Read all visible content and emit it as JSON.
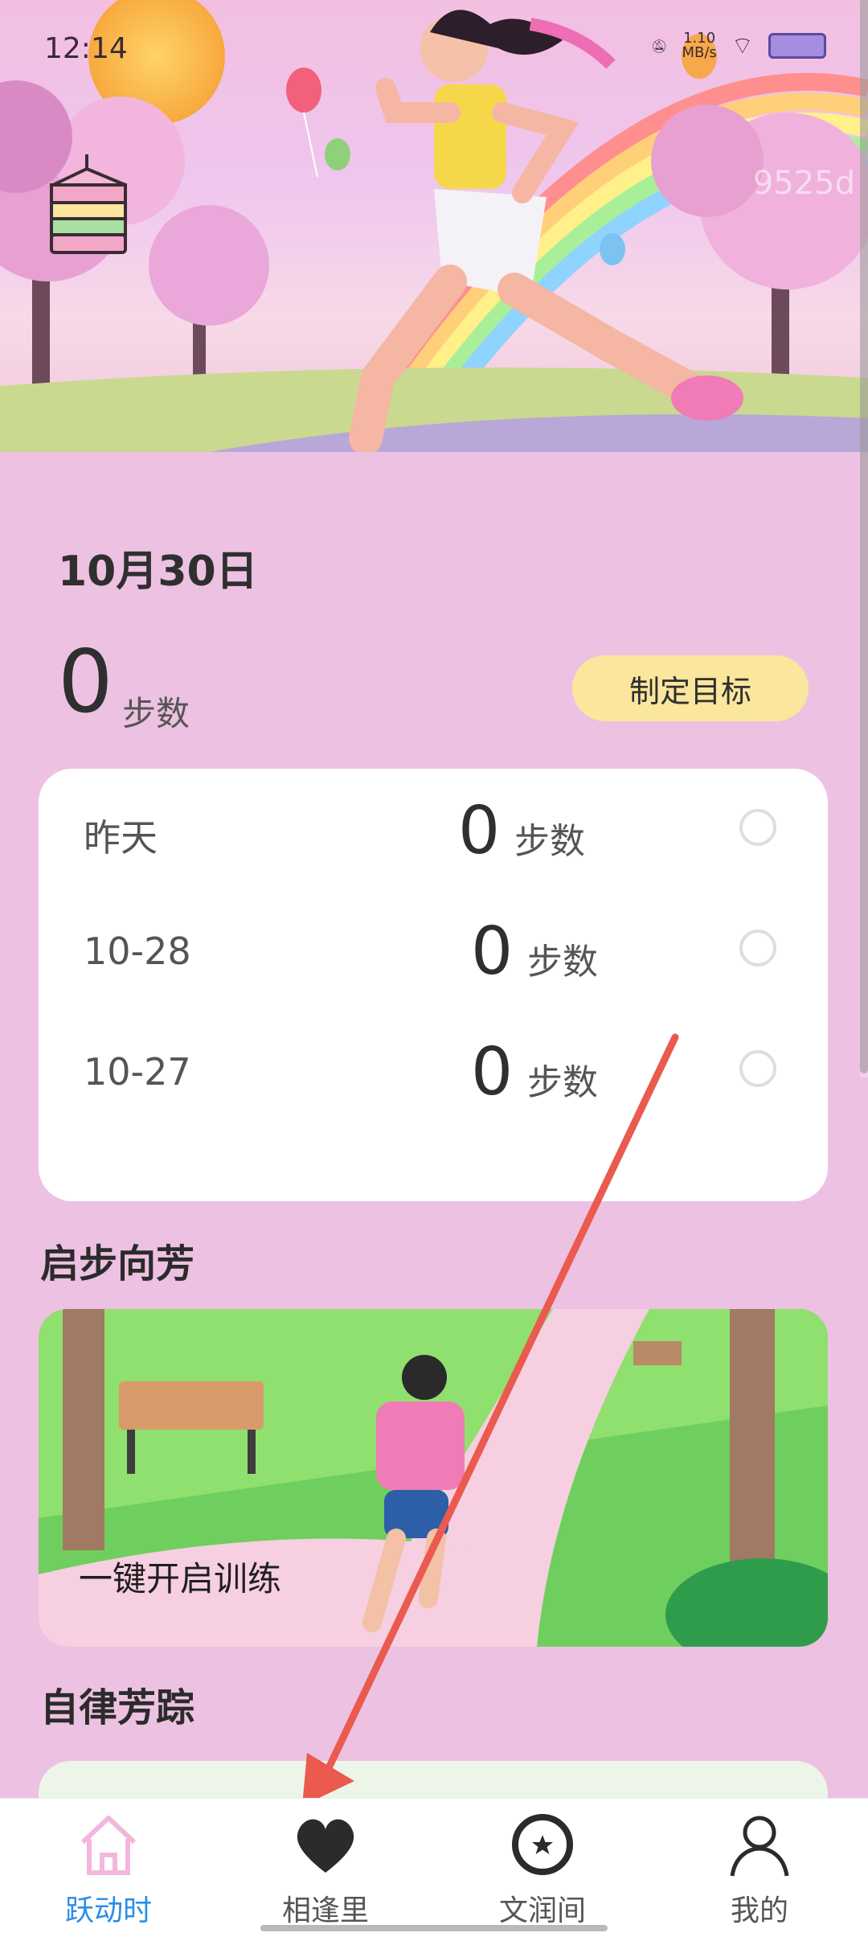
{
  "status_bar": {
    "time": "12:14",
    "net_speed": "1.10\nMB/s"
  },
  "hero": {
    "watermark": "9525d"
  },
  "today": {
    "date": "10月30日",
    "steps": "0",
    "unit": "步数",
    "goal_button": "制定目标"
  },
  "history": [
    {
      "label": "昨天",
      "steps": "0",
      "unit": "步数"
    },
    {
      "label": "10-28",
      "steps": "0",
      "unit": "步数"
    },
    {
      "label": "10-27",
      "steps": "0",
      "unit": "步数"
    }
  ],
  "sections": {
    "start": {
      "title": "启步向芳",
      "card_label": "一键开启训练"
    },
    "track": {
      "title": "自律芳踪"
    }
  },
  "nav": [
    {
      "label": "跃动时",
      "icon": "home-icon",
      "active": true
    },
    {
      "label": "相逢里",
      "icon": "heart-icon",
      "active": false
    },
    {
      "label": "文润间",
      "icon": "star-circle-icon",
      "active": false
    },
    {
      "label": "我的",
      "icon": "person-icon",
      "active": false
    }
  ],
  "colors": {
    "background": "#edc1e2",
    "goal_button": "#fbe69d",
    "nav_active": "#2a8ee8",
    "arrow": "#ea5a4e"
  }
}
